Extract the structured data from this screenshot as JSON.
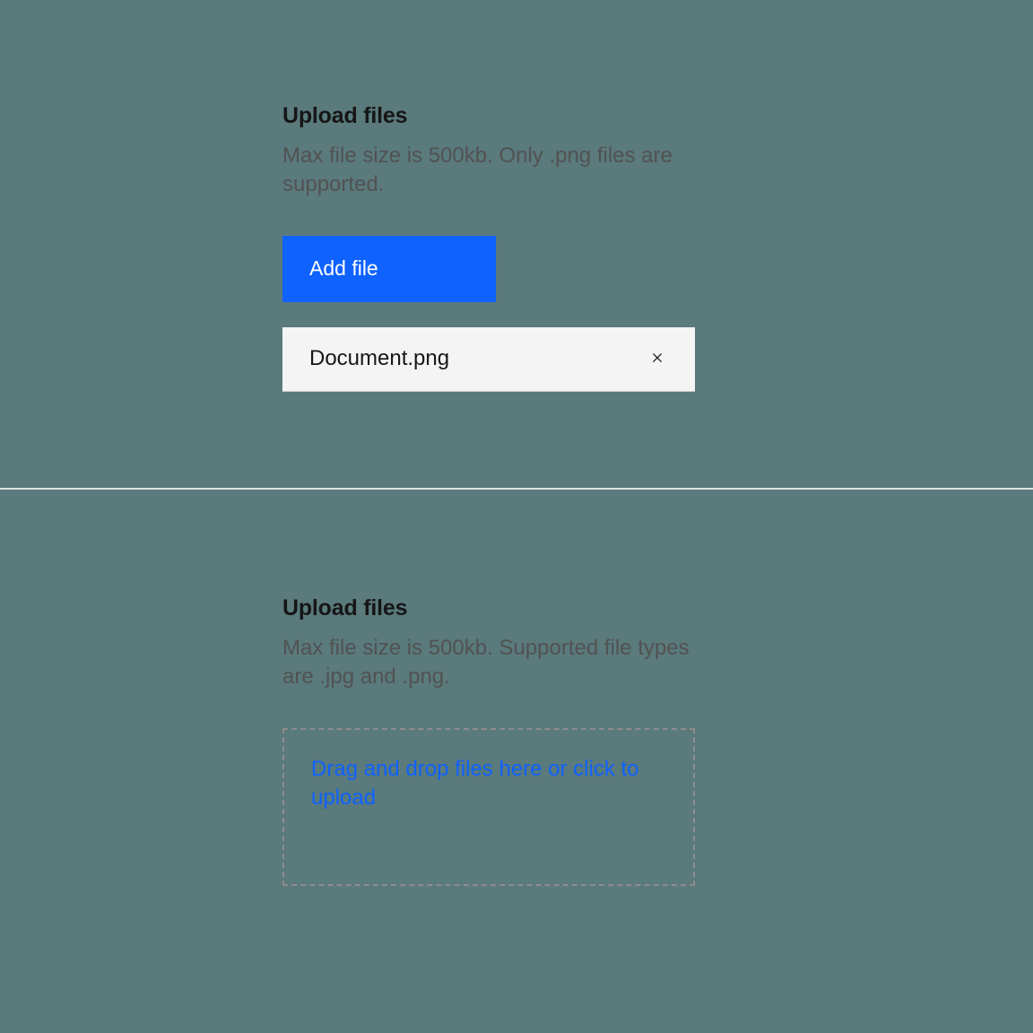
{
  "upload1": {
    "title": "Upload files",
    "description": "Max file size is 500kb. Only .png files are supported.",
    "button_label": "Add file",
    "files": [
      {
        "name": "Document.png"
      }
    ]
  },
  "upload2": {
    "title": "Upload files",
    "description": "Max file size is 500kb. Supported file types are .jpg and .png.",
    "dropzone_text": "Drag and drop files here or click to upload"
  },
  "colors": {
    "primary": "#0f62fe",
    "background": "#5a7a7c",
    "file_bg": "#f4f4f4",
    "text_primary": "#161616",
    "text_secondary": "#525252",
    "border_dashed": "#8d8d8d"
  }
}
